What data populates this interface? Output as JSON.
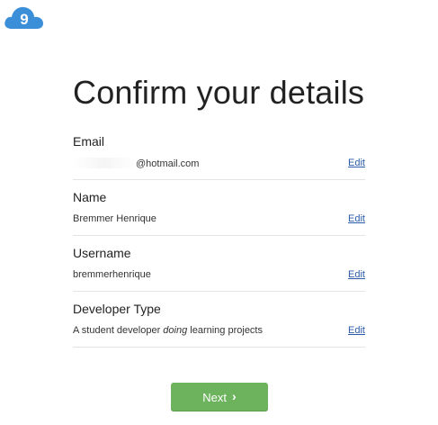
{
  "brand": {
    "logo_glyph": "9",
    "logo_color": "#3a8fd8"
  },
  "page": {
    "title": "Confirm your details"
  },
  "details": [
    {
      "key": "email",
      "label": "Email",
      "value_prefix": "",
      "value": "@hotmail.com",
      "value_em": "",
      "value_suffix": "",
      "edit_label": "Edit"
    },
    {
      "key": "name",
      "label": "Name",
      "value_prefix": "",
      "value": "Bremmer Henrique",
      "value_em": "",
      "value_suffix": "",
      "edit_label": "Edit"
    },
    {
      "key": "username",
      "label": "Username",
      "value_prefix": "",
      "value": "bremmerhenrique",
      "value_em": "",
      "value_suffix": "",
      "edit_label": "Edit"
    },
    {
      "key": "developer-type",
      "label": "Developer Type",
      "value_prefix": "A student developer ",
      "value": "",
      "value_em": "doing",
      "value_suffix": " learning projects",
      "edit_label": "Edit"
    }
  ],
  "actions": {
    "next_label": "Next",
    "next_icon": "chevron-right-icon",
    "accent_color": "#6db25c",
    "link_color": "#2a5aa8"
  }
}
